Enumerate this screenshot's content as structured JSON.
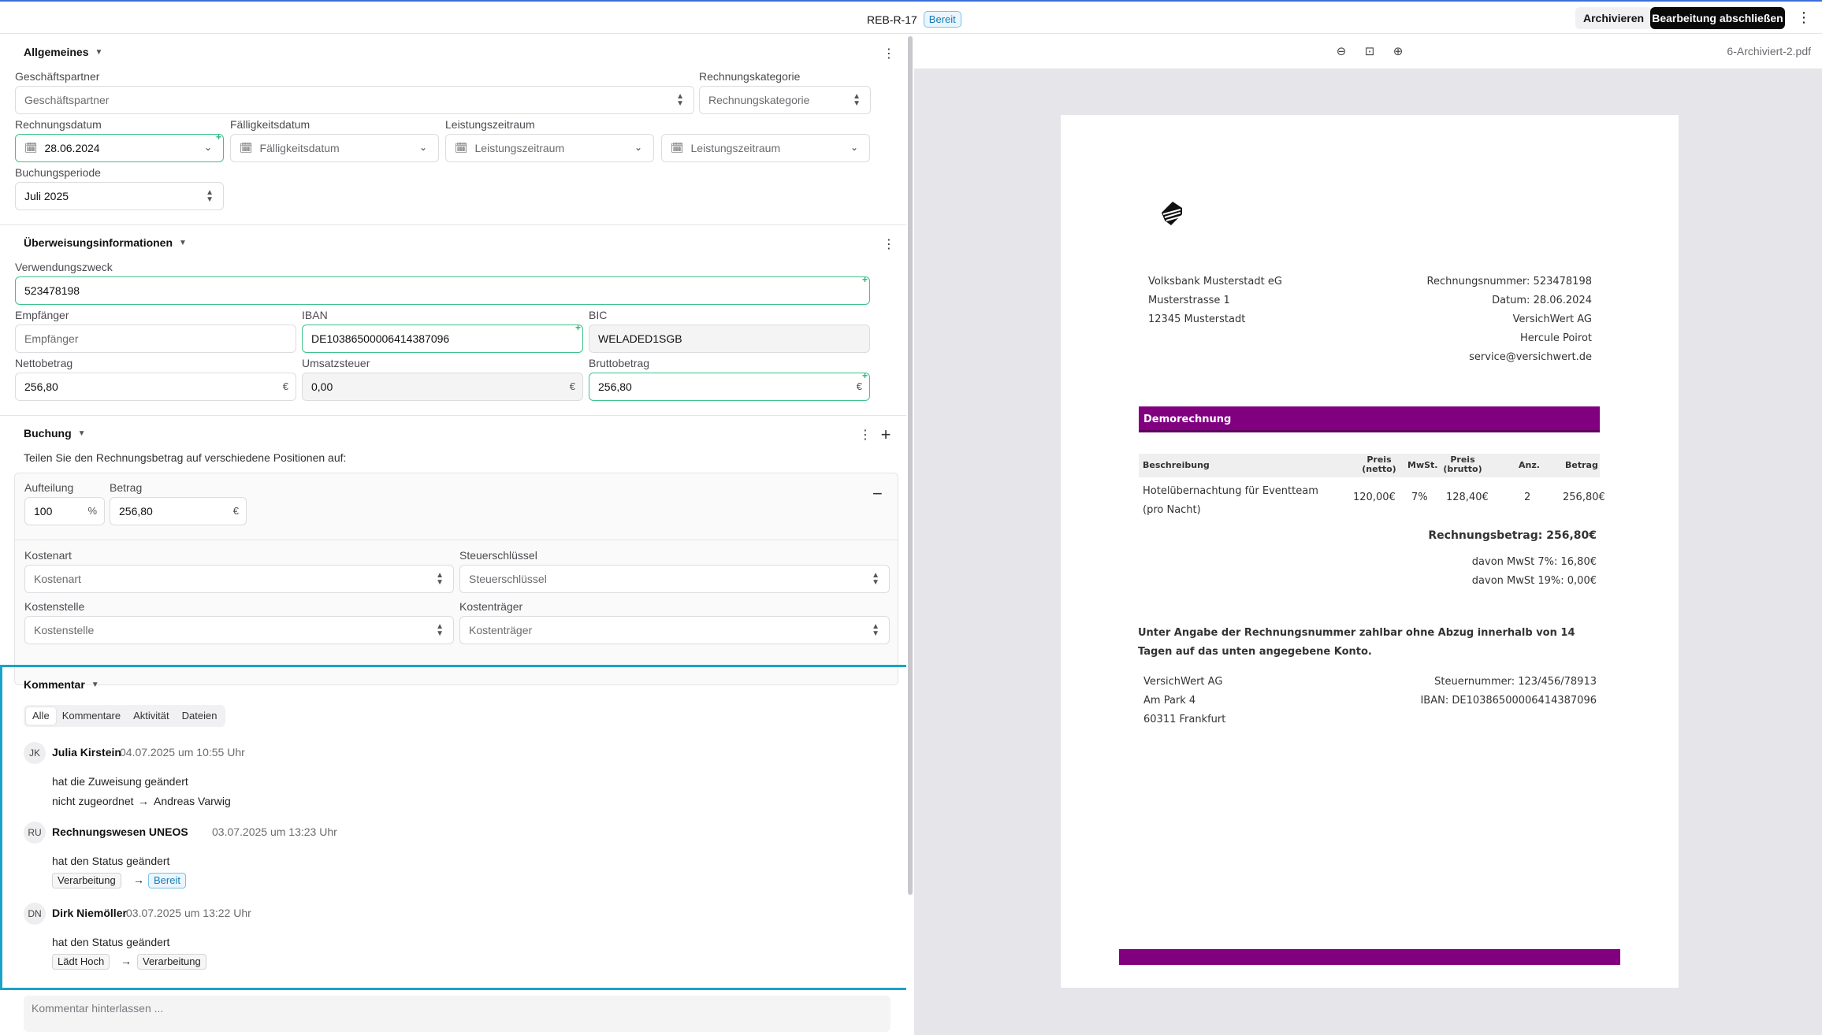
{
  "header": {
    "doc_id": "REB-R-17",
    "status": "Bereit",
    "archive_label": "Archivieren",
    "finish_label": "Bearbeitung abschließen",
    "more_icon": "more-vertical-icon"
  },
  "allgemeines": {
    "title": "Allgemeines",
    "partner_label": "Geschäftspartner",
    "partner_placeholder": "Geschäftspartner",
    "category_label": "Rechnungskategorie",
    "category_placeholder": "Rechnungskategorie",
    "invoice_date_label": "Rechnungsdatum",
    "invoice_date_value": "28.06.2024",
    "due_date_label": "Fälligkeitsdatum",
    "due_date_placeholder": "Fälligkeitsdatum",
    "service_period_label": "Leistungszeitraum",
    "service_period_placeholder_1": "Leistungszeitraum",
    "service_period_placeholder_2": "Leistungszeitraum",
    "booking_period_label": "Buchungsperiode",
    "booking_period_value": "Juli 2025"
  },
  "ueberweisung": {
    "title": "Überweisungsinformationen",
    "purpose_label": "Verwendungszweck",
    "purpose_value": "523478198",
    "recipient_label": "Empfänger",
    "recipient_placeholder": "Empfänger",
    "iban_label": "IBAN",
    "iban_value": "DE10386500006414387096",
    "bic_label": "BIC",
    "bic_value": "WELADED1SGB",
    "net_label": "Nettobetrag",
    "net_value": "256,80",
    "vat_label": "Umsatzsteuer",
    "vat_value": "0,00",
    "gross_label": "Bruttobetrag",
    "gross_value": "256,80",
    "currency": "€"
  },
  "buchung": {
    "title": "Buchung",
    "hint": "Teilen Sie den Rechnungsbetrag auf verschiedene Positionen auf:",
    "split_label": "Aufteilung",
    "split_value": "100",
    "split_unit": "%",
    "amount_label": "Betrag",
    "amount_value": "256,80",
    "amount_unit": "€",
    "cost_type_label": "Kostenart",
    "cost_type_placeholder": "Kostenart",
    "tax_key_label": "Steuerschlüssel",
    "tax_key_placeholder": "Steuerschlüssel",
    "cost_center_label": "Kostenstelle",
    "cost_center_placeholder": "Kostenstelle",
    "cost_unit_label": "Kostenträger",
    "cost_unit_placeholder": "Kostenträger"
  },
  "kommentar": {
    "title": "Kommentar",
    "tabs": [
      "Alle",
      "Kommentare",
      "Aktivität",
      "Dateien"
    ],
    "entries": [
      {
        "initials": "JK",
        "name": "Julia Kirstein",
        "time": "04.07.2025 um 10:55 Uhr",
        "action": "hat die Zuweisung geändert",
        "from": "nicht zugeordnet",
        "to": "Andreas Varwig"
      },
      {
        "initials": "RU",
        "name": "Rechnungswesen UNEOS",
        "time": "03.07.2025 um 13:23 Uhr",
        "action": "hat den Status geändert",
        "from": "Verarbeitung",
        "to": "Bereit"
      },
      {
        "initials": "DN",
        "name": "Dirk Niemöller",
        "time": "03.07.2025 um 13:22 Uhr",
        "action": "hat den Status geändert",
        "from": "Lädt Hoch",
        "to": "Verarbeitung"
      }
    ],
    "input_placeholder": "Kommentar hinterlassen ..."
  },
  "viewer": {
    "file_name": "6-Archiviert-2.pdf"
  },
  "document": {
    "sender": [
      "Volksbank Musterstadt eG",
      "Musterstrasse 1",
      "12345 Musterstadt"
    ],
    "info": [
      "Rechnungsnummer: 523478198",
      "Datum: 28.06.2024",
      "VersichWert AG",
      "Hercule Poirot",
      "service@versichwert.de"
    ],
    "banner": "Demorechnung",
    "table_headers": [
      "Beschreibung",
      "Preis (netto)",
      "MwSt.",
      "Preis (brutto)",
      "Anz.",
      "Betrag"
    ],
    "row": [
      "Hotelübernachtung für Eventteam (pro Nacht)",
      "120,00€",
      "7%",
      "128,40€",
      "2",
      "256,80€"
    ],
    "total": "Rechnungsbetrag: 256,80€",
    "vat7": "davon MwSt 7%: 16,80€",
    "vat19": "davon MwSt 19%: 0,00€",
    "payment_note": "Unter Angabe der Rechnungsnummer zahlbar ohne Abzug innerhalb von 14 Tagen auf das unten angegebene Konto.",
    "footer_left": [
      "VersichWert AG",
      "Am Park 4",
      "60311 Frankfurt"
    ],
    "footer_right": [
      "Steuernummer: 123/456/78913",
      "IBAN: DE10386500006414387096"
    ],
    "accent": "#800080"
  }
}
